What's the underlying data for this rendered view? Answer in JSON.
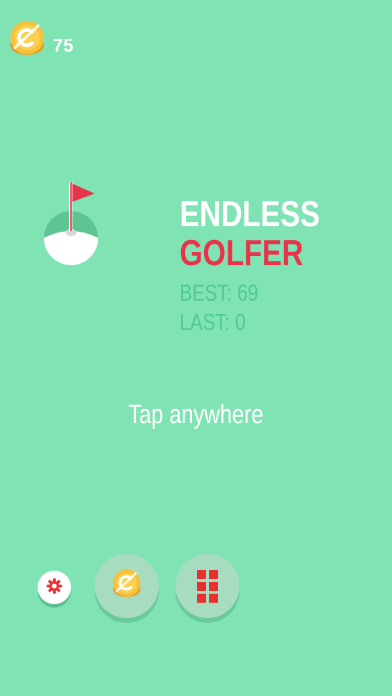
{
  "hud": {
    "coins": "75",
    "coin_icon": "coin-icon"
  },
  "title": {
    "line1": "ENDLESS",
    "line2": "GOLFER"
  },
  "scores": {
    "best": "BEST: 69",
    "last": "LAST: 0"
  },
  "hint": "Tap anywhere",
  "buttons": {
    "settings": "gear-icon",
    "shop": "coin-icon",
    "levels": "grid-icon"
  },
  "colors": {
    "background": "#80e3b4",
    "title_white": "#ffffff",
    "title_red": "#e8344a",
    "score_text": "#4fc98f",
    "button_bg": "#a8dcc1",
    "accent_red": "#e8302e",
    "coin_gold": "#f6c13b"
  }
}
